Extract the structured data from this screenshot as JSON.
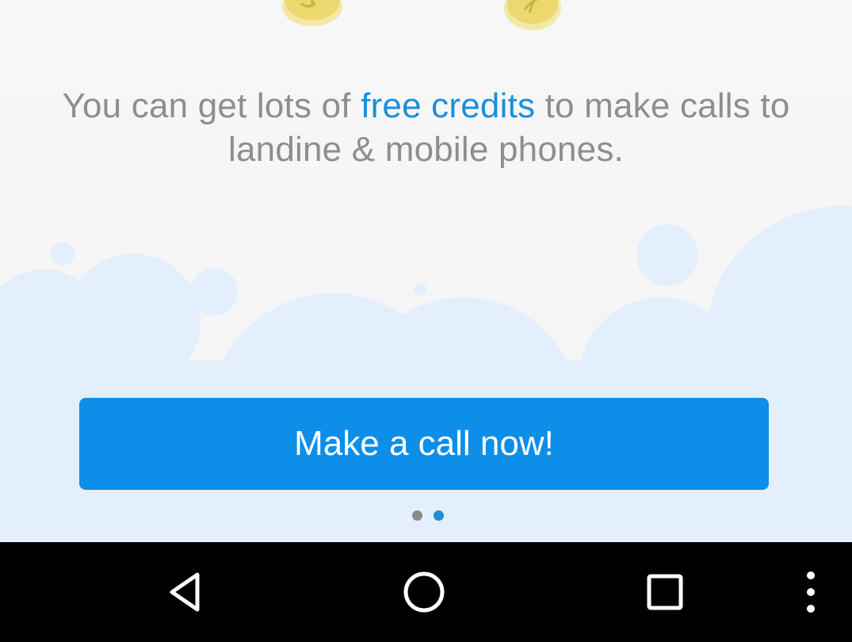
{
  "onboarding": {
    "headline_part1": "You can get lots of ",
    "headline_highlight": "free credits",
    "headline_part2": " to make calls to landine & mobile phones.",
    "cta_label": "Make a call now!",
    "pager": {
      "total": 2,
      "active_index": 1
    }
  },
  "colors": {
    "accent": "#0d8ee9",
    "highlight_text": "#1b8fd8",
    "body_text": "#8e8e8e",
    "cloud": "#e3effc",
    "coin": "#f1e38e",
    "navbar": "#000000"
  },
  "icons": {
    "coin_left": "coin-icon",
    "coin_right": "coin-icon",
    "nav_back": "back-triangle-icon",
    "nav_home": "home-circle-icon",
    "nav_recent": "recent-apps-square-icon",
    "nav_menu": "overflow-menu-icon"
  }
}
